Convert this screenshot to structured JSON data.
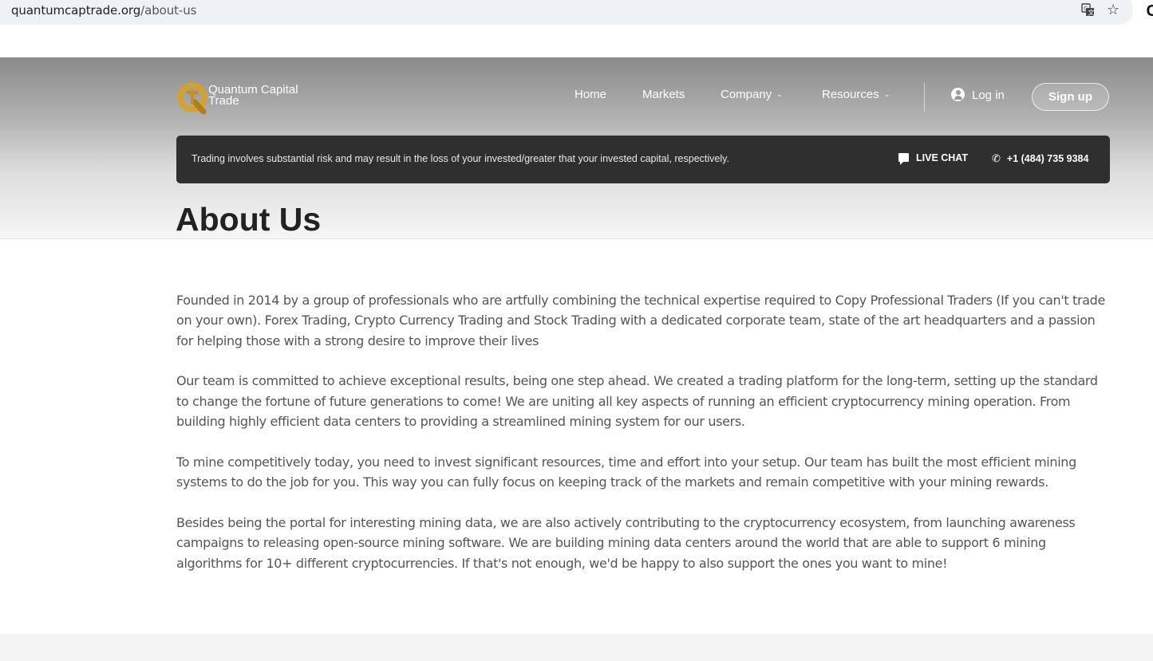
{
  "browser": {
    "url_domain": "quantumcaptrade.org",
    "url_path": "/about-us"
  },
  "brand": {
    "name_line1": "Quantum Capital",
    "name_line2": "Trade",
    "accent": "#d4a227"
  },
  "nav": {
    "items": [
      {
        "label": "Home",
        "has_dropdown": false
      },
      {
        "label": "Markets",
        "has_dropdown": false
      },
      {
        "label": "Company",
        "has_dropdown": true
      },
      {
        "label": "Resources",
        "has_dropdown": true
      }
    ],
    "login_label": "Log in",
    "signup_label": "Sign up"
  },
  "riskbar": {
    "text": "Trading involves substantial risk and may result in the loss of your invested/greater that your invested capital, respectively.",
    "chat_label": "LIVE CHAT",
    "phone": "+1 (484) 735 9384"
  },
  "page": {
    "title": "About Us",
    "paragraphs": [
      "Founded in 2014 by a group of professionals who are artfully combining the technical expertise required to Copy Professional Traders (If you can't trade on your own). Forex Trading, Crypto Currency Trading and Stock Trading with a dedicated corporate team, state of the art headquarters and a passion for helping those with a strong desire to improve their lives",
      "Our team is committed to achieve exceptional results, being one step ahead. We created a trading platform for the long-term, setting up the standard to change the fortune of future generations to come! We are uniting all key aspects of running an efficient cryptocurrency mining operation. From building highly efficient data centers to providing a streamlined mining system for our users.",
      "To mine competitively today, you need to invest significant resources, time and effort into your setup. Our team has built the most efficient mining systems to do the job for you. This way you can fully focus on keeping track of the markets and remain competitive with your mining rewards.",
      "Besides being the portal for interesting mining data, we are also actively contributing to the cryptocurrency ecosystem, from launching awareness campaigns to releasing open-source mining software. We are building mining data centers around the world that are able to support 6 mining algorithms for 10+ different cryptocurrencies. If that's not enough, we'd be happy to also support the ones you want to mine!"
    ]
  }
}
